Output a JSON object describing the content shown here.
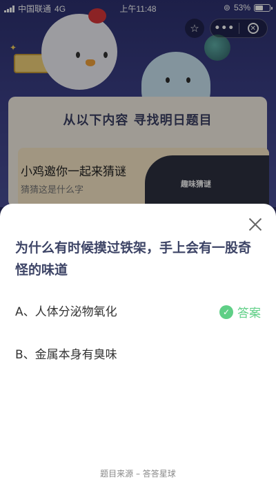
{
  "status_bar": {
    "carrier": "中国联通",
    "network": "4G",
    "time": "上午11:48",
    "battery": "53%"
  },
  "background": {
    "banner_title": "从以下内容 寻找明日题目",
    "promo_title": "小鸡邀你一起来猜谜",
    "promo_subtitle": "猜猜这是什么字",
    "promo_tag": "趣味猜谜"
  },
  "capsule": {
    "more": "•••"
  },
  "sheet": {
    "question": "为什么有时候摸过铁架，手上会有一股奇怪的味道",
    "options": [
      {
        "label": "A、人体分泌物氧化"
      },
      {
        "label": "B、金属本身有臭味"
      }
    ],
    "answer_label": "答案",
    "source": "题目来源 – 答答星球"
  },
  "colors": {
    "accent_green": "#5fcf86",
    "question_text": "#3d4466",
    "background_dark": "#2d3170"
  }
}
